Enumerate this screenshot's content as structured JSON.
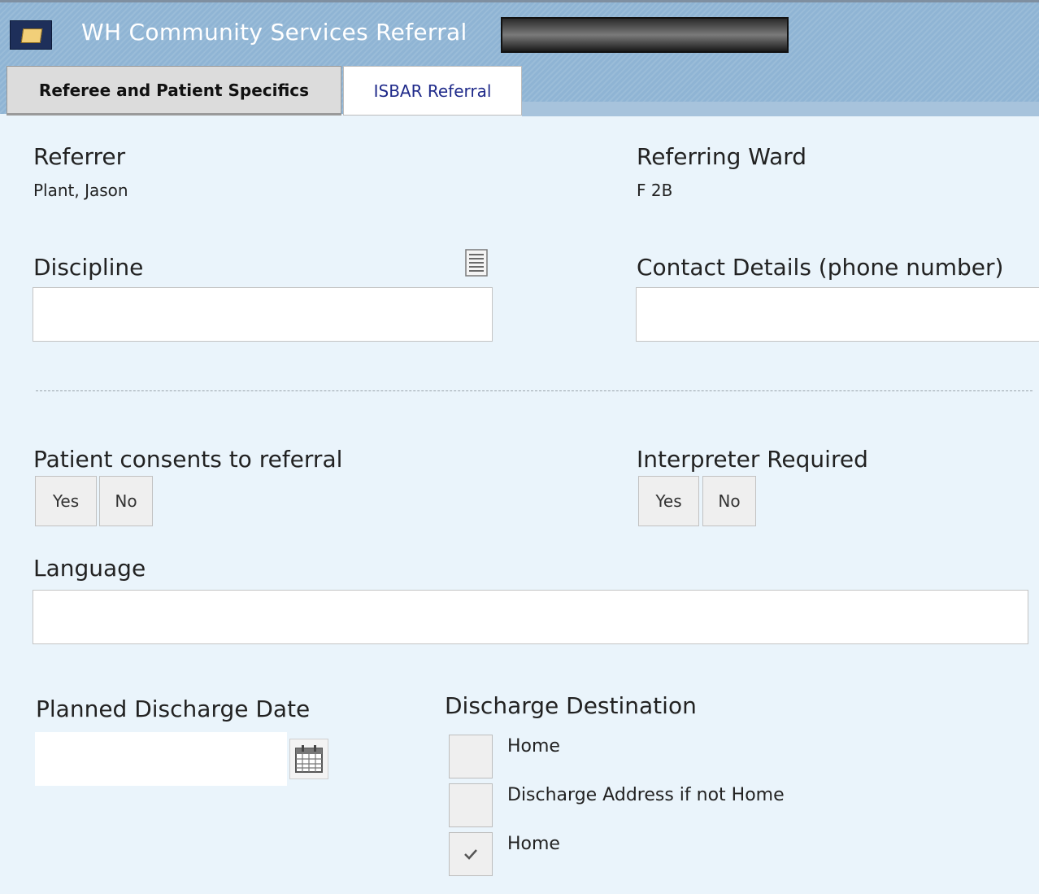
{
  "window": {
    "title": "WH Community Services Referral"
  },
  "tabs": [
    {
      "label": "Referee and Patient Specifics",
      "active": true
    },
    {
      "label": "ISBAR Referral",
      "active": false
    }
  ],
  "form": {
    "referrer": {
      "label": "Referrer",
      "value": "Plant, Jason"
    },
    "referring_ward": {
      "label": "Referring Ward",
      "value": "F 2B"
    },
    "discipline": {
      "label": "Discipline",
      "value": "",
      "lookup_icon": "list-lookup-icon"
    },
    "contact": {
      "label": "Contact Details (phone number)",
      "value": ""
    },
    "consent": {
      "label": "Patient consents to referral",
      "yes": "Yes",
      "no": "No"
    },
    "interpreter": {
      "label": "Interpreter Required",
      "yes": "Yes",
      "no": "No"
    },
    "language": {
      "label": "Language",
      "value": ""
    },
    "discharge_date": {
      "label": "Planned Discharge Date",
      "value": "",
      "icon": "calendar-icon"
    },
    "discharge_destination": {
      "label": "Discharge Destination",
      "options": [
        {
          "label": "Home",
          "checked": false
        },
        {
          "label": "Discharge Address if not Home",
          "checked": false
        },
        {
          "label": "Home",
          "checked": true
        }
      ]
    }
  },
  "colors": {
    "background": "#eaf4fb",
    "header": "#8fb4d4",
    "tab_active": "#dcdcdc",
    "tab_inactive_text": "#1f2a8a"
  }
}
